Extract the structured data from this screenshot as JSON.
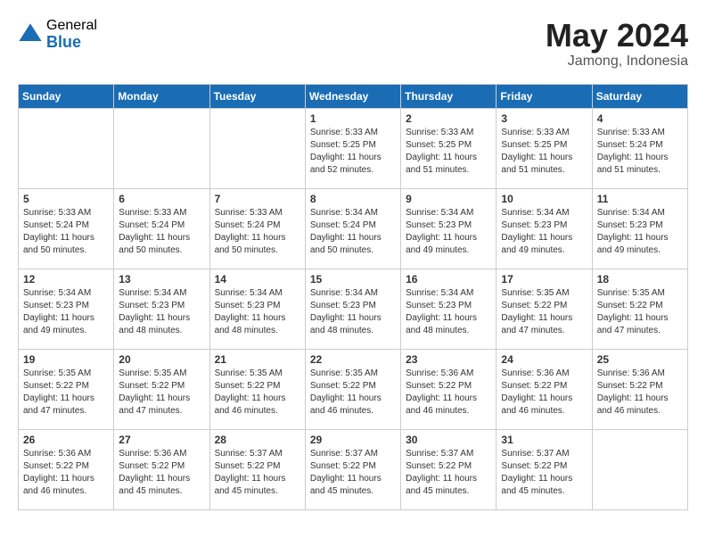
{
  "header": {
    "logo_general": "General",
    "logo_blue": "Blue",
    "month_title": "May 2024",
    "location": "Jamong, Indonesia"
  },
  "days_of_week": [
    "Sunday",
    "Monday",
    "Tuesday",
    "Wednesday",
    "Thursday",
    "Friday",
    "Saturday"
  ],
  "weeks": [
    {
      "alt": false,
      "days": [
        {
          "num": "",
          "empty": true
        },
        {
          "num": "",
          "empty": true
        },
        {
          "num": "",
          "empty": true
        },
        {
          "num": "1",
          "sunrise": "5:33 AM",
          "sunset": "5:25 PM",
          "daylight": "11 hours and 52 minutes."
        },
        {
          "num": "2",
          "sunrise": "5:33 AM",
          "sunset": "5:25 PM",
          "daylight": "11 hours and 51 minutes."
        },
        {
          "num": "3",
          "sunrise": "5:33 AM",
          "sunset": "5:25 PM",
          "daylight": "11 hours and 51 minutes."
        },
        {
          "num": "4",
          "sunrise": "5:33 AM",
          "sunset": "5:24 PM",
          "daylight": "11 hours and 51 minutes."
        }
      ]
    },
    {
      "alt": true,
      "days": [
        {
          "num": "5",
          "sunrise": "5:33 AM",
          "sunset": "5:24 PM",
          "daylight": "11 hours and 50 minutes."
        },
        {
          "num": "6",
          "sunrise": "5:33 AM",
          "sunset": "5:24 PM",
          "daylight": "11 hours and 50 minutes."
        },
        {
          "num": "7",
          "sunrise": "5:33 AM",
          "sunset": "5:24 PM",
          "daylight": "11 hours and 50 minutes."
        },
        {
          "num": "8",
          "sunrise": "5:34 AM",
          "sunset": "5:24 PM",
          "daylight": "11 hours and 50 minutes."
        },
        {
          "num": "9",
          "sunrise": "5:34 AM",
          "sunset": "5:23 PM",
          "daylight": "11 hours and 49 minutes."
        },
        {
          "num": "10",
          "sunrise": "5:34 AM",
          "sunset": "5:23 PM",
          "daylight": "11 hours and 49 minutes."
        },
        {
          "num": "11",
          "sunrise": "5:34 AM",
          "sunset": "5:23 PM",
          "daylight": "11 hours and 49 minutes."
        }
      ]
    },
    {
      "alt": false,
      "days": [
        {
          "num": "12",
          "sunrise": "5:34 AM",
          "sunset": "5:23 PM",
          "daylight": "11 hours and 49 minutes."
        },
        {
          "num": "13",
          "sunrise": "5:34 AM",
          "sunset": "5:23 PM",
          "daylight": "11 hours and 48 minutes."
        },
        {
          "num": "14",
          "sunrise": "5:34 AM",
          "sunset": "5:23 PM",
          "daylight": "11 hours and 48 minutes."
        },
        {
          "num": "15",
          "sunrise": "5:34 AM",
          "sunset": "5:23 PM",
          "daylight": "11 hours and 48 minutes."
        },
        {
          "num": "16",
          "sunrise": "5:34 AM",
          "sunset": "5:23 PM",
          "daylight": "11 hours and 48 minutes."
        },
        {
          "num": "17",
          "sunrise": "5:35 AM",
          "sunset": "5:22 PM",
          "daylight": "11 hours and 47 minutes."
        },
        {
          "num": "18",
          "sunrise": "5:35 AM",
          "sunset": "5:22 PM",
          "daylight": "11 hours and 47 minutes."
        }
      ]
    },
    {
      "alt": true,
      "days": [
        {
          "num": "19",
          "sunrise": "5:35 AM",
          "sunset": "5:22 PM",
          "daylight": "11 hours and 47 minutes."
        },
        {
          "num": "20",
          "sunrise": "5:35 AM",
          "sunset": "5:22 PM",
          "daylight": "11 hours and 47 minutes."
        },
        {
          "num": "21",
          "sunrise": "5:35 AM",
          "sunset": "5:22 PM",
          "daylight": "11 hours and 46 minutes."
        },
        {
          "num": "22",
          "sunrise": "5:35 AM",
          "sunset": "5:22 PM",
          "daylight": "11 hours and 46 minutes."
        },
        {
          "num": "23",
          "sunrise": "5:36 AM",
          "sunset": "5:22 PM",
          "daylight": "11 hours and 46 minutes."
        },
        {
          "num": "24",
          "sunrise": "5:36 AM",
          "sunset": "5:22 PM",
          "daylight": "11 hours and 46 minutes."
        },
        {
          "num": "25",
          "sunrise": "5:36 AM",
          "sunset": "5:22 PM",
          "daylight": "11 hours and 46 minutes."
        }
      ]
    },
    {
      "alt": false,
      "days": [
        {
          "num": "26",
          "sunrise": "5:36 AM",
          "sunset": "5:22 PM",
          "daylight": "11 hours and 46 minutes."
        },
        {
          "num": "27",
          "sunrise": "5:36 AM",
          "sunset": "5:22 PM",
          "daylight": "11 hours and 45 minutes."
        },
        {
          "num": "28",
          "sunrise": "5:37 AM",
          "sunset": "5:22 PM",
          "daylight": "11 hours and 45 minutes."
        },
        {
          "num": "29",
          "sunrise": "5:37 AM",
          "sunset": "5:22 PM",
          "daylight": "11 hours and 45 minutes."
        },
        {
          "num": "30",
          "sunrise": "5:37 AM",
          "sunset": "5:22 PM",
          "daylight": "11 hours and 45 minutes."
        },
        {
          "num": "31",
          "sunrise": "5:37 AM",
          "sunset": "5:22 PM",
          "daylight": "11 hours and 45 minutes."
        },
        {
          "num": "",
          "empty": true
        }
      ]
    }
  ]
}
